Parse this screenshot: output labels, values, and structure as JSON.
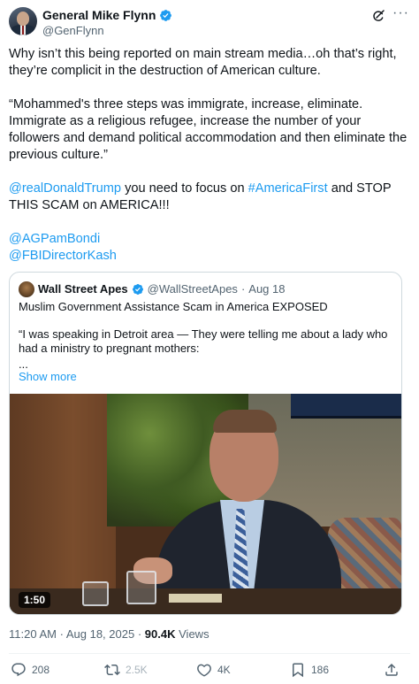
{
  "author": {
    "display_name": "General Mike Flynn",
    "handle": "@GenFlynn",
    "verified_icon": "verified-badge-icon",
    "accent": "#1d9bf0"
  },
  "post": {
    "paragraph1": "Why isn’t this being reported on main stream media…oh that’s right, they’re complicit in the destruction of American culture.",
    "paragraph2": "“Mohammed's three steps was immigrate, increase, eliminate. Immigrate as a religious refugee, increase the number of your followers and demand political accommodation and then eliminate the previous culture.”",
    "mention_trump": "@realDonaldTrump",
    "text_focus": " you need to focus on ",
    "hashtag": "#AmericaFirst",
    "text_stop": " and STOP THIS SCAM on AMERICA!!!",
    "mention_bondi": "@AGPamBondi",
    "mention_kash": "@FBIDirectorKash"
  },
  "quote": {
    "display_name": "Wall Street Apes",
    "handle": "@WallStreetApes",
    "separator": "·",
    "date": "Aug 18",
    "title": "Muslim Government Assistance Scam in America EXPOSED",
    "body": "“I was speaking in Detroit area — They were telling me about a lady who had a ministry to pregnant mothers:",
    "ellipsis": "...",
    "show_more": "Show more",
    "video_duration": "1:50"
  },
  "meta": {
    "time": "11:20 AM",
    "separator": "·",
    "date": "Aug 18, 2025",
    "separator2": "·",
    "views_count": "90.4K",
    "views_label": "Views"
  },
  "actions": {
    "replies": "208",
    "reposts": "2.5K",
    "likes": "4K",
    "bookmarks": "186"
  }
}
